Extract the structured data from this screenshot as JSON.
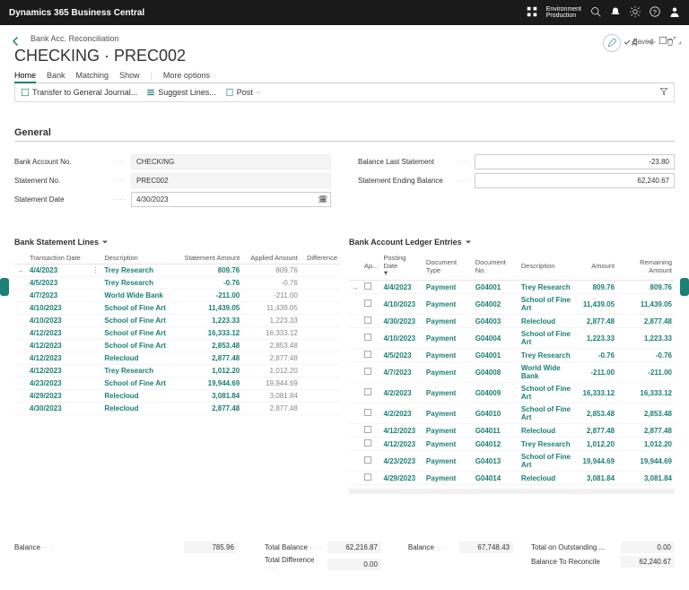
{
  "brand": "Dynamics 365 Business Central",
  "env": {
    "line1": "Environment",
    "line2": "Production"
  },
  "crumb": "Bank Acc. Reconciliation",
  "title": "CHECKING · PREC002",
  "tabs": {
    "home": "Home",
    "bank": "Bank",
    "matching": "Matching",
    "show": "Show",
    "more": "More options"
  },
  "actions": {
    "transfer": "Transfer to General Journal...",
    "suggest": "Suggest Lines...",
    "post": "Post"
  },
  "saved_label": "Saved",
  "section_general": "General",
  "fields": {
    "bank_no_label": "Bank Account No.",
    "bank_no": "CHECKING",
    "stmt_no_label": "Statement No.",
    "stmt_no": "PREC002",
    "stmt_date_label": "Statement Date",
    "stmt_date": "4/30/2023",
    "bal_last_label": "Balance Last Statement",
    "bal_last": "-23.80",
    "stmt_end_label": "Statement Ending Balance",
    "stmt_end": "62,240.67"
  },
  "left_grid": {
    "title": "Bank Statement Lines",
    "cols": {
      "date": "Transaction Date",
      "desc": "Description",
      "stmt": "Statement Amount",
      "applied": "Applied Amount",
      "diff": "Difference"
    },
    "rows": [
      {
        "date": "4/4/2023",
        "desc": "Trey Research",
        "stmt": "809.76",
        "applied": "809.76",
        "diff": ""
      },
      {
        "date": "4/5/2023",
        "desc": "Trey Research",
        "stmt": "-0.76",
        "applied": "-0.76",
        "diff": ""
      },
      {
        "date": "4/7/2023",
        "desc": "World Wide Bank",
        "stmt": "-211.00",
        "applied": "-211.00",
        "diff": ""
      },
      {
        "date": "4/10/2023",
        "desc": "School of Fine Art",
        "stmt": "11,439.05",
        "applied": "11,439.05",
        "diff": ""
      },
      {
        "date": "4/10/2023",
        "desc": "School of Fine Art",
        "stmt": "1,223.33",
        "applied": "1,223.33",
        "diff": ""
      },
      {
        "date": "4/12/2023",
        "desc": "School of Fine Art",
        "stmt": "16,333.12",
        "applied": "16,333.12",
        "diff": ""
      },
      {
        "date": "4/12/2023",
        "desc": "School of Fine Art",
        "stmt": "2,853.48",
        "applied": "2,853.48",
        "diff": ""
      },
      {
        "date": "4/12/2023",
        "desc": "Relecloud",
        "stmt": "2,877.48",
        "applied": "2,877.48",
        "diff": ""
      },
      {
        "date": "4/12/2023",
        "desc": "Trey Research",
        "stmt": "1,012.20",
        "applied": "1,012.20",
        "diff": ""
      },
      {
        "date": "4/23/2023",
        "desc": "School of Fine Art",
        "stmt": "19,944.69",
        "applied": "19,944.69",
        "diff": ""
      },
      {
        "date": "4/29/2023",
        "desc": "Relecloud",
        "stmt": "3,081.84",
        "applied": "3,081.84",
        "diff": ""
      },
      {
        "date": "4/30/2023",
        "desc": "Relecloud",
        "stmt": "2,877.48",
        "applied": "2,877.48",
        "diff": ""
      }
    ]
  },
  "right_grid": {
    "title": "Bank Account Ledger Entries",
    "cols": {
      "app": "Ap...",
      "pdate": "Posting Date",
      "dtype": "Document Type",
      "dno": "Document No.",
      "desc": "Description",
      "amount": "Amount",
      "remain": "Remaining Amount"
    },
    "rows": [
      {
        "date": "4/4/2023",
        "type": "Payment",
        "no": "G04001",
        "desc": "Trey Research",
        "amount": "809.76",
        "remain": "809.76"
      },
      {
        "date": "4/10/2023",
        "type": "Payment",
        "no": "G04002",
        "desc": "School of Fine Art",
        "amount": "11,439.05",
        "remain": "11,439.05"
      },
      {
        "date": "4/30/2023",
        "type": "Payment",
        "no": "G04003",
        "desc": "Relecloud",
        "amount": "2,877.48",
        "remain": "2,877.48"
      },
      {
        "date": "4/10/2023",
        "type": "Payment",
        "no": "G04004",
        "desc": "School of Fine Art",
        "amount": "1,223.33",
        "remain": "1,223.33"
      },
      {
        "date": "4/5/2023",
        "type": "Payment",
        "no": "G04001",
        "desc": "Trey Research",
        "amount": "-0.76",
        "remain": "-0.76"
      },
      {
        "date": "4/7/2023",
        "type": "Payment",
        "no": "G04008",
        "desc": "World Wide Bank",
        "amount": "-211.00",
        "remain": "-211.00"
      },
      {
        "date": "4/2/2023",
        "type": "Payment",
        "no": "G04009",
        "desc": "School of Fine Art",
        "amount": "16,333.12",
        "remain": "16,333.12"
      },
      {
        "date": "4/2/2023",
        "type": "Payment",
        "no": "G04010",
        "desc": "School of Fine Art",
        "amount": "2,853.48",
        "remain": "2,853.48"
      },
      {
        "date": "4/12/2023",
        "type": "Payment",
        "no": "G04011",
        "desc": "Relecloud",
        "amount": "2,877.48",
        "remain": "2,877.48"
      },
      {
        "date": "4/12/2023",
        "type": "Payment",
        "no": "G04012",
        "desc": "Trey Research",
        "amount": "1,012.20",
        "remain": "1,012.20"
      },
      {
        "date": "4/23/2023",
        "type": "Payment",
        "no": "G04013",
        "desc": "School of Fine Art",
        "amount": "19,944.69",
        "remain": "19,944.69"
      },
      {
        "date": "4/29/2023",
        "type": "Payment",
        "no": "G04014",
        "desc": "Relecloud",
        "amount": "3,081.84",
        "remain": "3,081.84"
      }
    ]
  },
  "totals": {
    "balance_label": "Balance",
    "balance_left": "785.96",
    "total_balance_label": "Total Balance",
    "total_balance": "62,216.87",
    "total_diff_label": "Total Difference",
    "total_diff": "0.00",
    "balance_right": "67,748.43",
    "total_outstanding_label": "Total on Outstanding ...",
    "total_outstanding": "0.00",
    "balance_to_reconcile_label": "Balance To Reconcile",
    "balance_to_reconcile": "62,240.67"
  }
}
